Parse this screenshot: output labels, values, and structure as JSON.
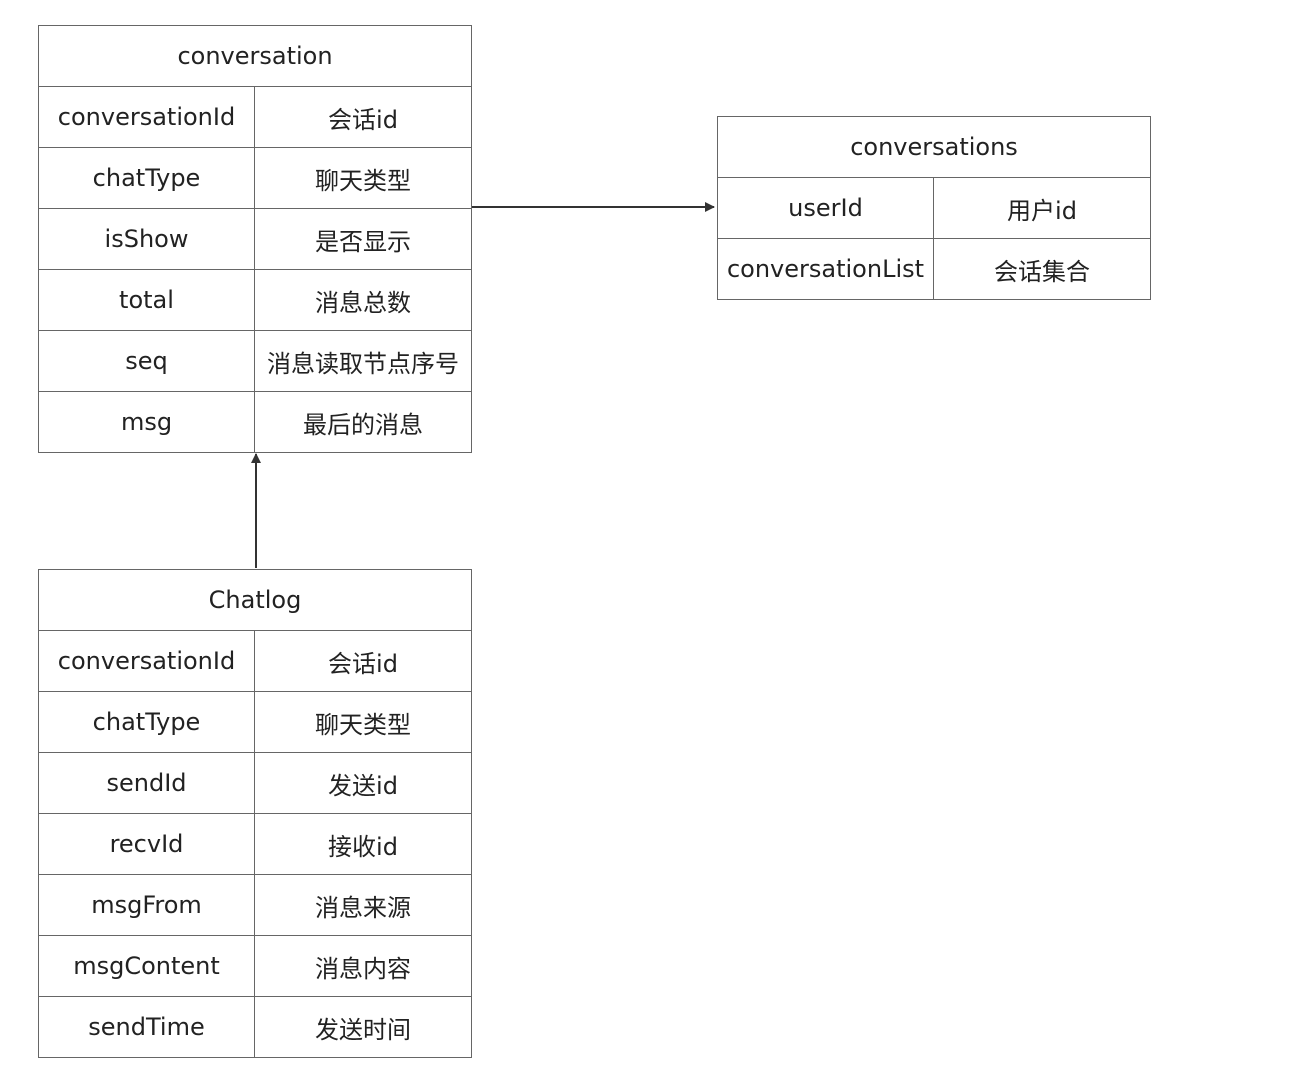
{
  "entities": {
    "conversation": {
      "title": "conversation",
      "rows": [
        {
          "field": "conversationId",
          "desc": "会话id"
        },
        {
          "field": "chatType",
          "desc": "聊天类型"
        },
        {
          "field": "isShow",
          "desc": "是否显示"
        },
        {
          "field": "total",
          "desc": "消息总数"
        },
        {
          "field": "seq",
          "desc": "消息读取节点序号"
        },
        {
          "field": "msg",
          "desc": "最后的消息"
        }
      ]
    },
    "conversations": {
      "title": "conversations",
      "rows": [
        {
          "field": "userId",
          "desc": "用户id"
        },
        {
          "field": "conversationList",
          "desc": "会话集合"
        }
      ]
    },
    "chatlog": {
      "title": "Chatlog",
      "rows": [
        {
          "field": "conversationId",
          "desc": "会话id"
        },
        {
          "field": "chatType",
          "desc": "聊天类型"
        },
        {
          "field": "sendId",
          "desc": "发送id"
        },
        {
          "field": "recvId",
          "desc": "接收id"
        },
        {
          "field": "msgFrom",
          "desc": "消息来源"
        },
        {
          "field": "msgContent",
          "desc": "消息内容"
        },
        {
          "field": "sendTime",
          "desc": "发送时间"
        }
      ]
    }
  },
  "connectors": [
    {
      "from": "conversation",
      "to": "conversations"
    },
    {
      "from": "chatlog",
      "to": "conversation"
    }
  ],
  "colors": {
    "border": "#666666",
    "arrow": "#333333",
    "text": "#222222"
  }
}
